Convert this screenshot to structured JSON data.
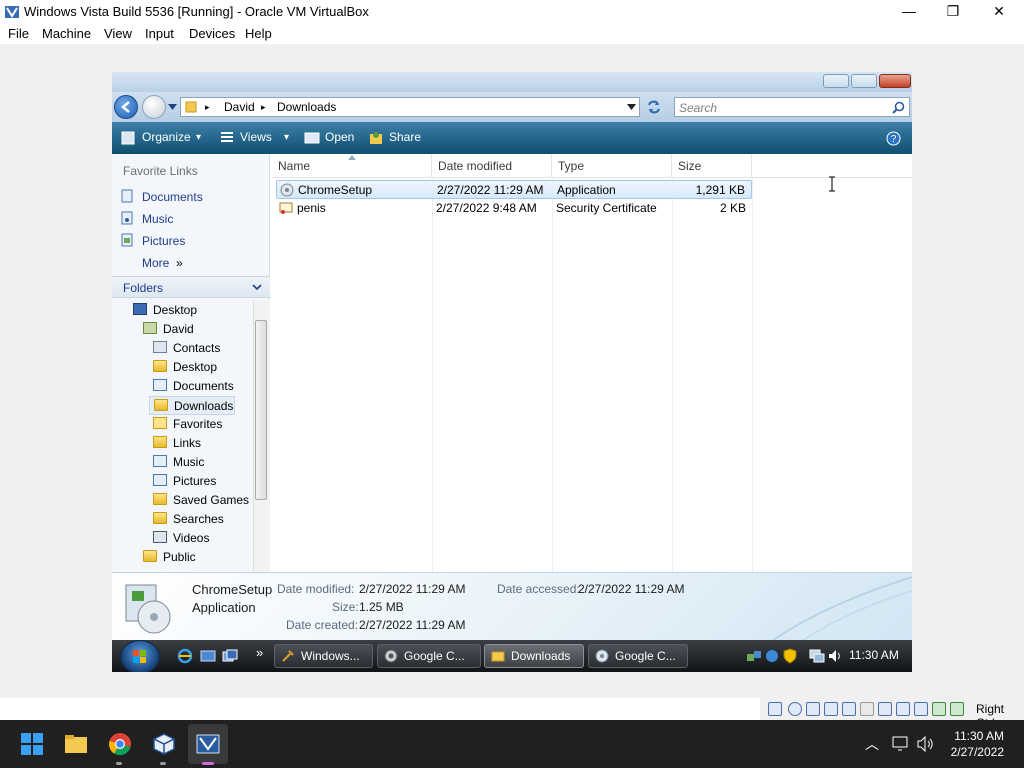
{
  "host_window": {
    "title": "Windows Vista Build 5536 [Running] - Oracle VM VirtualBox",
    "minimize_glyph": "—",
    "restore_glyph": "❐",
    "close_glyph": "✕"
  },
  "host_menu": [
    "File",
    "Machine",
    "View",
    "Input",
    "Devices",
    "Help"
  ],
  "explorer": {
    "breadcrumb": [
      "David",
      "Downloads"
    ],
    "breadcrumb_sep": "▸",
    "search_placeholder": "Search",
    "toolbar": {
      "organize": "Organize",
      "views": "Views",
      "open": "Open",
      "share": "Share",
      "dropdown_glyph": "▾"
    },
    "favorite_links_title": "Favorite Links",
    "favorite_links": [
      "Documents",
      "Music",
      "Pictures"
    ],
    "more_label": "More",
    "more_glyph": "»",
    "folders_label": "Folders",
    "folders_chevron": "⌄",
    "tree": [
      {
        "label": "Desktop",
        "level": 0,
        "icon": "desktop-icon"
      },
      {
        "label": "David",
        "level": 1,
        "icon": "user-folder-icon"
      },
      {
        "label": "Contacts",
        "level": 2,
        "icon": "contacts-icon"
      },
      {
        "label": "Desktop",
        "level": 2,
        "icon": "folder-icon"
      },
      {
        "label": "Documents",
        "level": 2,
        "icon": "documents-icon"
      },
      {
        "label": "Downloads",
        "level": 2,
        "icon": "folder-icon",
        "selected": true
      },
      {
        "label": "Favorites",
        "level": 2,
        "icon": "favorites-icon"
      },
      {
        "label": "Links",
        "level": 2,
        "icon": "folder-icon"
      },
      {
        "label": "Music",
        "level": 2,
        "icon": "music-icon"
      },
      {
        "label": "Pictures",
        "level": 2,
        "icon": "pictures-icon"
      },
      {
        "label": "Saved Games",
        "level": 2,
        "icon": "folder-icon"
      },
      {
        "label": "Searches",
        "level": 2,
        "icon": "folder-icon"
      },
      {
        "label": "Videos",
        "level": 2,
        "icon": "videos-icon"
      },
      {
        "label": "Public",
        "level": 1,
        "icon": "folder-icon"
      }
    ],
    "columns": [
      "Name",
      "Date modified",
      "Type",
      "Size"
    ],
    "files": [
      {
        "name": "ChromeSetup",
        "date": "2/27/2022 11:29 AM",
        "type": "Application",
        "size": "1,291 KB",
        "selected": true,
        "icon": "installer-icon"
      },
      {
        "name": "penis",
        "date": "2/27/2022 9:48 AM",
        "type": "Security Certificate",
        "size": "2 KB",
        "selected": false,
        "icon": "certificate-icon"
      }
    ],
    "details": {
      "name": "ChromeSetup",
      "type": "Application",
      "date_modified_label": "Date modified:",
      "date_modified": "2/27/2022 11:29 AM",
      "size_label": "Size:",
      "size": "1.25 MB",
      "date_created_label": "Date created:",
      "date_created": "2/27/2022 11:29 AM",
      "date_accessed_label": "Date accessed:",
      "date_accessed": "2/27/2022 11:29 AM"
    }
  },
  "guest_taskbar": {
    "chevron": "»",
    "buttons": [
      {
        "label": "Windows...",
        "icon": "tools-icon",
        "active": false
      },
      {
        "label": "Google C...",
        "icon": "chrome-icon",
        "active": false
      },
      {
        "label": "Downloads",
        "icon": "folder-icon",
        "active": true
      },
      {
        "label": "Google C...",
        "icon": "chrome-setup-icon",
        "active": false
      }
    ],
    "clock": "11:30 AM"
  },
  "host_status": {
    "host_key": "Right Ctrl"
  },
  "host_taskbar": {
    "time": "11:30 AM",
    "date": "2/27/2022",
    "tray_chevron": "︿"
  },
  "colors": {
    "toolbar_blue": "#0f4f6f",
    "selection_blue": "#d6e9f9",
    "link_blue": "#1e3c8c",
    "host_taskbar": "#202020"
  }
}
